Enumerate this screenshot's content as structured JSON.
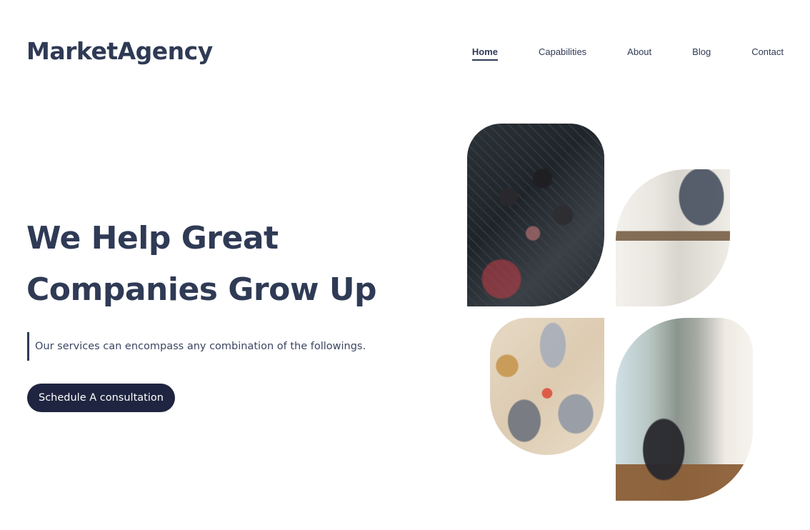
{
  "brand": {
    "logo": "MarketAgency"
  },
  "nav": {
    "items": [
      {
        "label": "Home",
        "active": true
      },
      {
        "label": "Capabilities",
        "active": false
      },
      {
        "label": "About",
        "active": false
      },
      {
        "label": "Blog",
        "active": false
      },
      {
        "label": "Contact",
        "active": false
      }
    ]
  },
  "hero": {
    "title_line1": "We Help Great",
    "title_line2": "Companies Grow Up",
    "lead": "Our services can encompass any combination of the followings.",
    "cta": "Schedule A consultation"
  },
  "colors": {
    "primary": "#2f3a55",
    "button": "#1f2540",
    "background": "#ffffff"
  }
}
